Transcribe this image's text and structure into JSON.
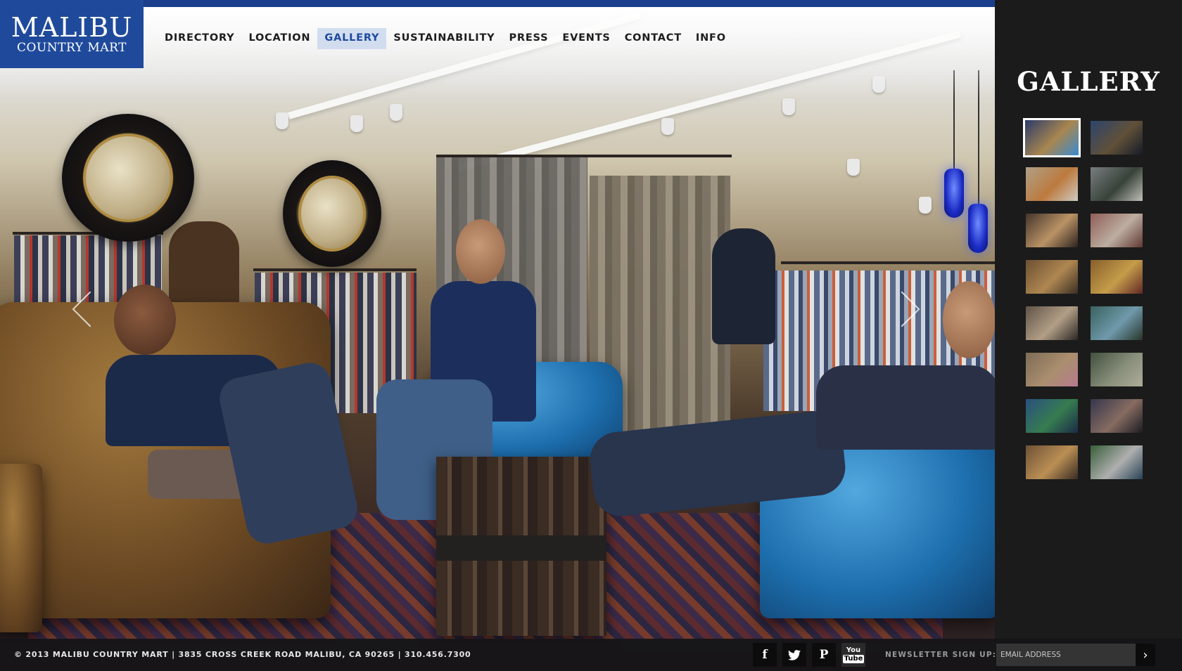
{
  "logo": {
    "line1": "MALIBU",
    "line2": "COUNTRY MART"
  },
  "nav": [
    {
      "label": "DIRECTORY"
    },
    {
      "label": "LOCATION"
    },
    {
      "label": "GALLERY",
      "active": true
    },
    {
      "label": "SUSTAINABILITY"
    },
    {
      "label": "PRESS"
    },
    {
      "label": "EVENTS"
    },
    {
      "label": "CONTACT"
    },
    {
      "label": "INFO"
    }
  ],
  "gallery": {
    "title": "GALLERY",
    "thumbnails": [
      {
        "active": true,
        "colors": [
          "#2b3b6a",
          "#a88650",
          "#3a8bd0"
        ]
      },
      {
        "colors": [
          "#2f4c7c",
          "#6e5a3e",
          "#141c2c"
        ]
      },
      {
        "colors": [
          "#c9b89a",
          "#d98b45",
          "#efe9dd"
        ]
      },
      {
        "colors": [
          "#8a8f93",
          "#3d4a3e",
          "#dcdcd6"
        ]
      },
      {
        "colors": [
          "#4b3a2e",
          "#d6a873",
          "#302520"
        ]
      },
      {
        "colors": [
          "#a56a62",
          "#d9c8b9",
          "#6d3d36"
        ]
      },
      {
        "colors": [
          "#7b5a36",
          "#c99a5b",
          "#3f3226"
        ]
      },
      {
        "colors": [
          "#9b6b2f",
          "#e3b453",
          "#6f2a28"
        ]
      },
      {
        "colors": [
          "#6c5e4f",
          "#cdb69a",
          "#2e2a27"
        ]
      },
      {
        "colors": [
          "#3f6f6a",
          "#7fb0c5",
          "#2b3a2d"
        ]
      },
      {
        "colors": [
          "#8e7a61",
          "#c4a37d",
          "#d28ba3"
        ]
      },
      {
        "colors": [
          "#4a5a45",
          "#9aa38b",
          "#c9c6b0"
        ]
      },
      {
        "colors": [
          "#2c5a8f",
          "#3c8e5a",
          "#1b2e4f"
        ]
      },
      {
        "colors": [
          "#3a3b55",
          "#9a7a6e",
          "#1c1c24"
        ]
      },
      {
        "colors": [
          "#7e5b3b",
          "#d7a45f",
          "#3e2f25"
        ]
      },
      {
        "colors": [
          "#3d6b3f",
          "#c9c9c9",
          "#2b4a60"
        ]
      }
    ]
  },
  "footer": {
    "copyright": "© 2013 MALIBU COUNTRY MART | 3835 CROSS CREEK ROAD MALIBU, CA 90265 | 310.456.7300",
    "social": [
      {
        "icon": "facebook-icon",
        "glyph": "f"
      },
      {
        "icon": "twitter-icon",
        "glyph": "🐦"
      },
      {
        "icon": "pinterest-icon",
        "glyph": "P"
      },
      {
        "icon": "youtube-icon",
        "glyph_top": "You",
        "glyph_bottom": "Tube"
      }
    ],
    "newsletter_label": "NEWSLETTER SIGN UP:",
    "email_placeholder": "EMAIL ADDRESS",
    "submit_glyph": "›"
  },
  "colors": {
    "brand": "#1f4a9c",
    "sidebar": "#1b1b1b",
    "footer": "#141416"
  }
}
